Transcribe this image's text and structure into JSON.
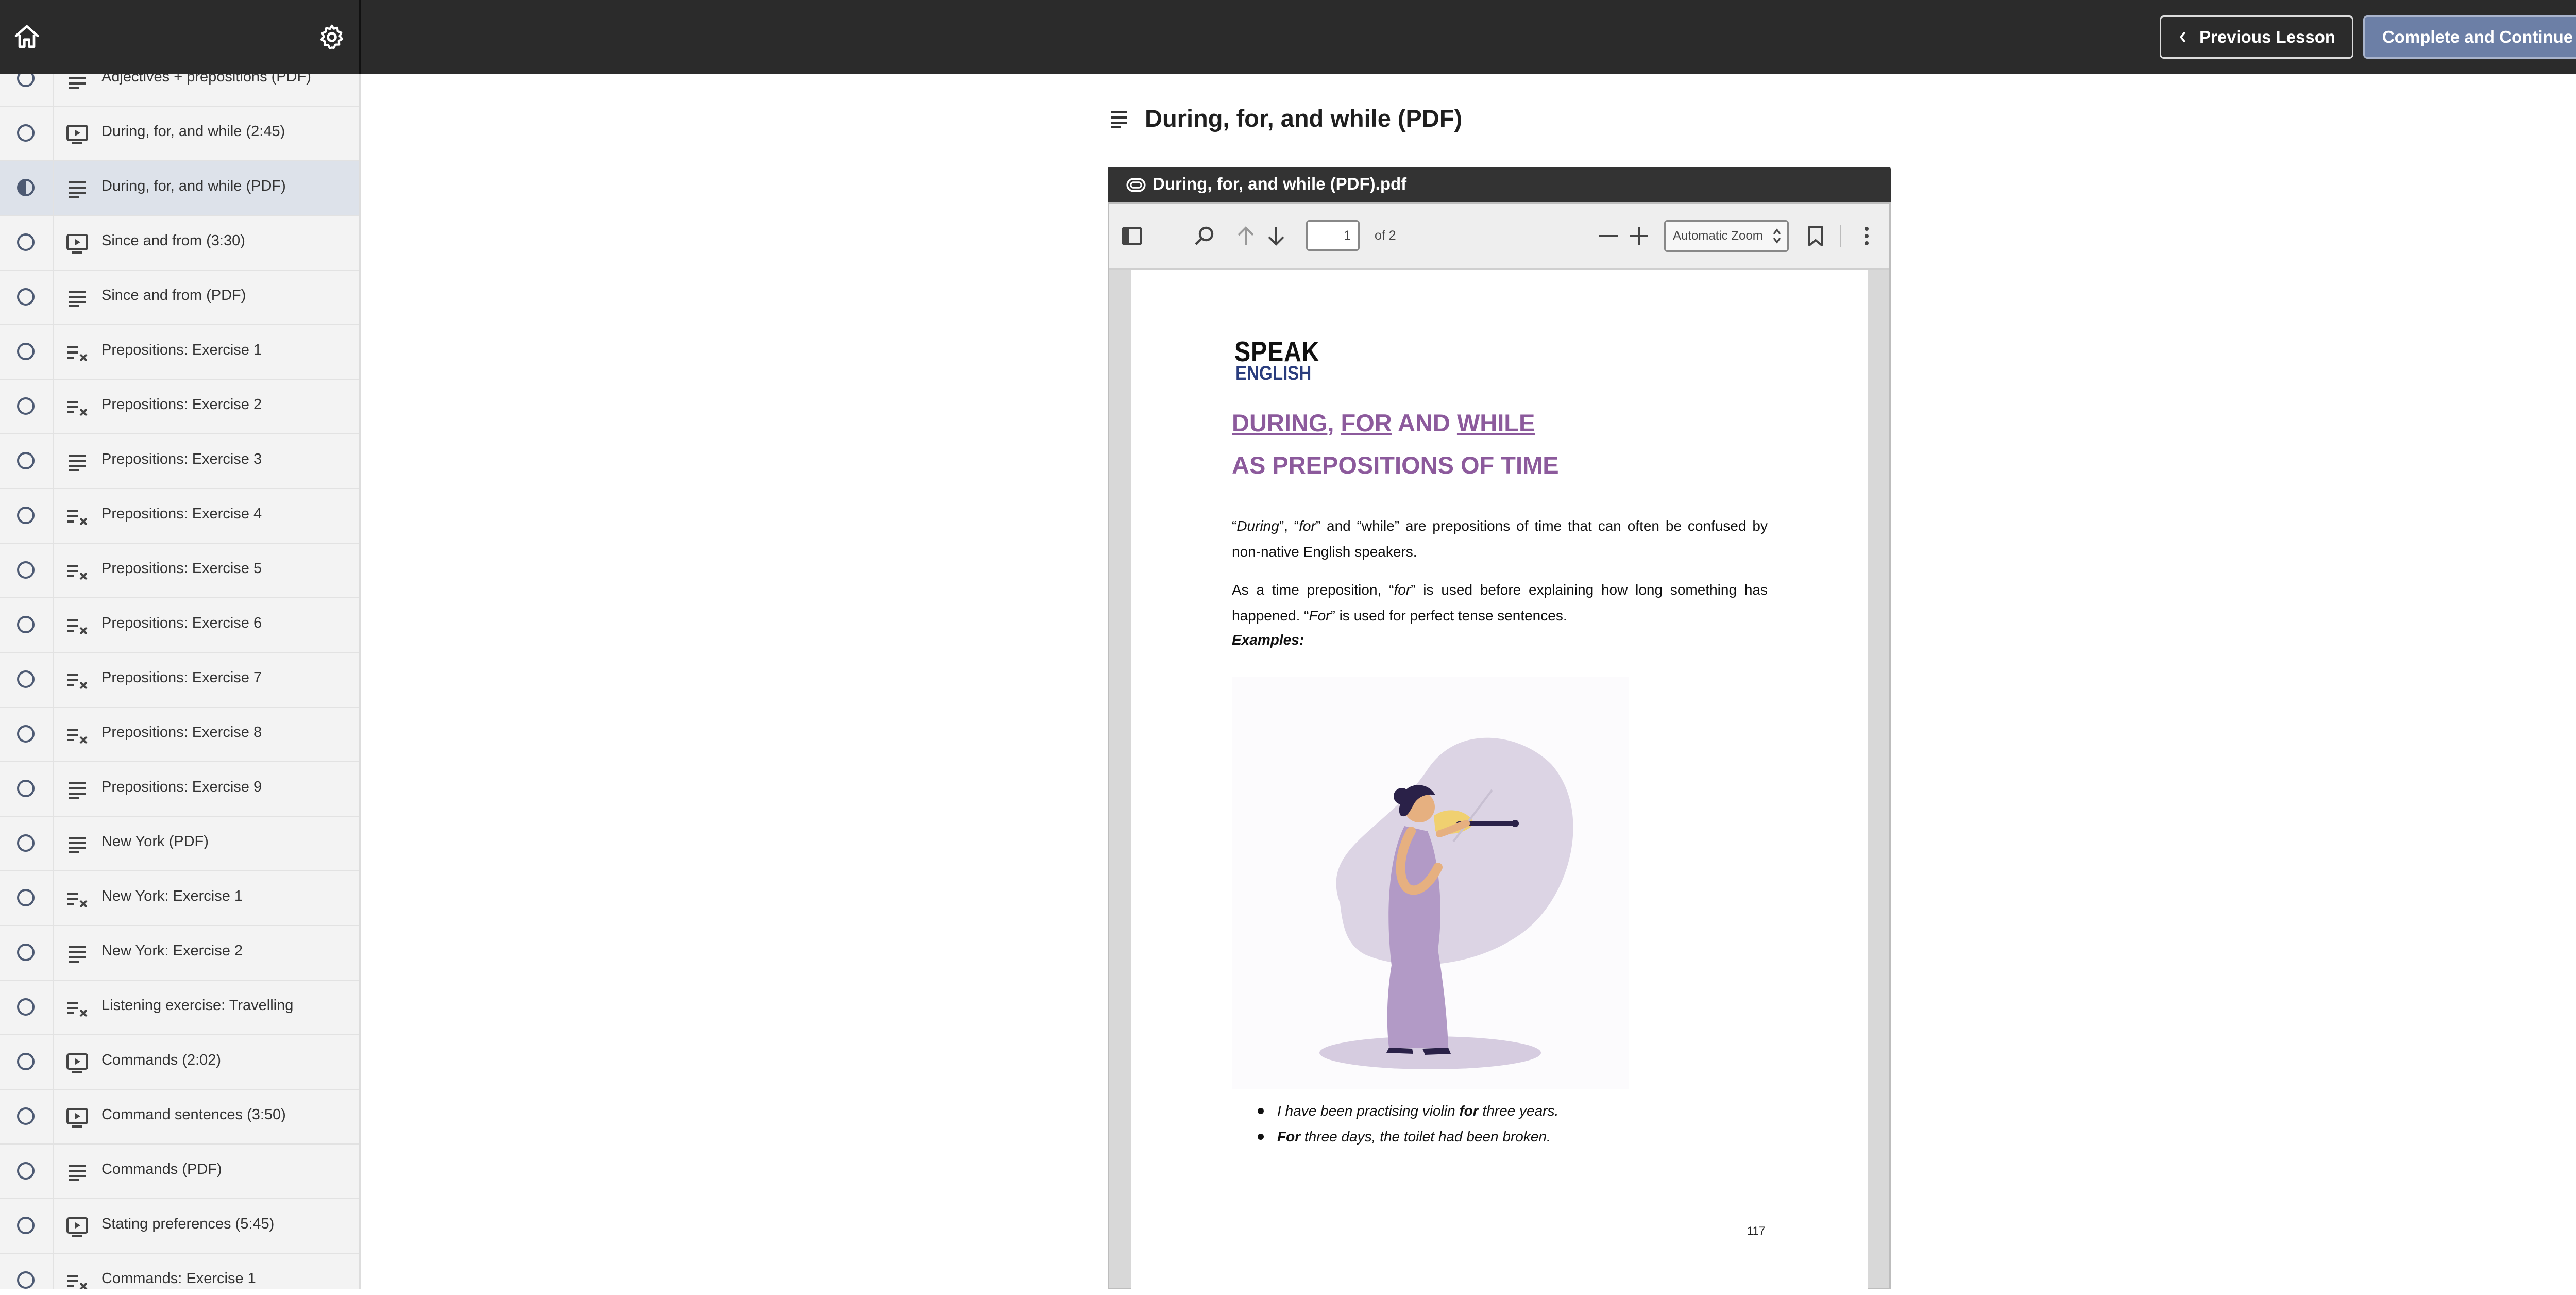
{
  "topbar": {
    "prev_label": "Previous Lesson",
    "next_label": "Complete and Continue"
  },
  "sidebar": {
    "items": [
      {
        "label": "Adjectives + prepositions (PDF)",
        "type": "document",
        "status": "empty"
      },
      {
        "label": "During, for, and while (2:45)",
        "type": "video",
        "status": "empty"
      },
      {
        "label": "During, for, and while (PDF)",
        "type": "document",
        "status": "in-progress"
      },
      {
        "label": "Since and from (3:30)",
        "type": "video",
        "status": "empty"
      },
      {
        "label": "Since and from (PDF)",
        "type": "document",
        "status": "empty"
      },
      {
        "label": "Prepositions: Exercise 1",
        "type": "quiz",
        "status": "empty"
      },
      {
        "label": "Prepositions: Exercise 2",
        "type": "quiz",
        "status": "empty"
      },
      {
        "label": "Prepositions: Exercise 3",
        "type": "document",
        "status": "empty"
      },
      {
        "label": "Prepositions: Exercise 4",
        "type": "quiz",
        "status": "empty"
      },
      {
        "label": "Prepositions: Exercise 5",
        "type": "quiz",
        "status": "empty"
      },
      {
        "label": "Prepositions: Exercise 6",
        "type": "quiz",
        "status": "empty"
      },
      {
        "label": "Prepositions: Exercise 7",
        "type": "quiz",
        "status": "empty"
      },
      {
        "label": "Prepositions: Exercise 8",
        "type": "quiz",
        "status": "empty"
      },
      {
        "label": "Prepositions: Exercise 9",
        "type": "document",
        "status": "empty"
      },
      {
        "label": "New York (PDF)",
        "type": "document",
        "status": "empty"
      },
      {
        "label": "New York: Exercise 1",
        "type": "quiz",
        "status": "empty"
      },
      {
        "label": "New York: Exercise 2",
        "type": "document",
        "status": "empty"
      },
      {
        "label": "Listening exercise: Travelling",
        "type": "quiz",
        "status": "empty"
      },
      {
        "label": "Commands (2:02)",
        "type": "video",
        "status": "empty"
      },
      {
        "label": "Command sentences (3:50)",
        "type": "video",
        "status": "empty"
      },
      {
        "label": "Commands (PDF)",
        "type": "document",
        "status": "empty"
      },
      {
        "label": "Stating preferences (5:45)",
        "type": "video",
        "status": "empty"
      },
      {
        "label": "Commands: Exercise 1",
        "type": "quiz",
        "status": "empty"
      }
    ]
  },
  "lesson": {
    "title": "During, for, and while (PDF)",
    "attachment_name": "During, for, and while (PDF).pdf"
  },
  "viewer": {
    "page_number": "1",
    "page_of": "of 2",
    "zoom": "Automatic Zoom"
  },
  "doc": {
    "logo_top": "SPEAK",
    "logo_bottom": "ENGLISH",
    "heading_during": "DURING",
    "heading_comma": ", ",
    "heading_for": "FOR",
    "heading_and": " AND ",
    "heading_while": "WHILE",
    "heading_line2": "AS PREPOSITIONS OF TIME",
    "p1_q1": "“",
    "p1_during": "During",
    "p1_q2": "”, “",
    "p1_for": "for",
    "p1_rest": "” and “while” are prepositions of time that can often be confused by non-native English speakers.",
    "p2_start": "As a time preposition, “",
    "p2_for": "for",
    "p2_mid": "” is used before explaining how long something has happened. “",
    "p2_For": "For",
    "p2_end": "” is used for perfect tense sentences.",
    "examples_label": "Examples:",
    "ex1_pre": "I have been practising violin ",
    "ex1_bold": "for",
    "ex1_post": " three years.",
    "ex2_bold": "For",
    "ex2_post": " three days, the toilet had been broken.",
    "page_num": "117"
  },
  "colors": {
    "topbar": "#2b2b2b",
    "primary_button": "#6c7fa6",
    "heading_purple": "#8c5a9c",
    "sidebar_active": "#dde2ea",
    "status_ring": "#4d5a73"
  }
}
